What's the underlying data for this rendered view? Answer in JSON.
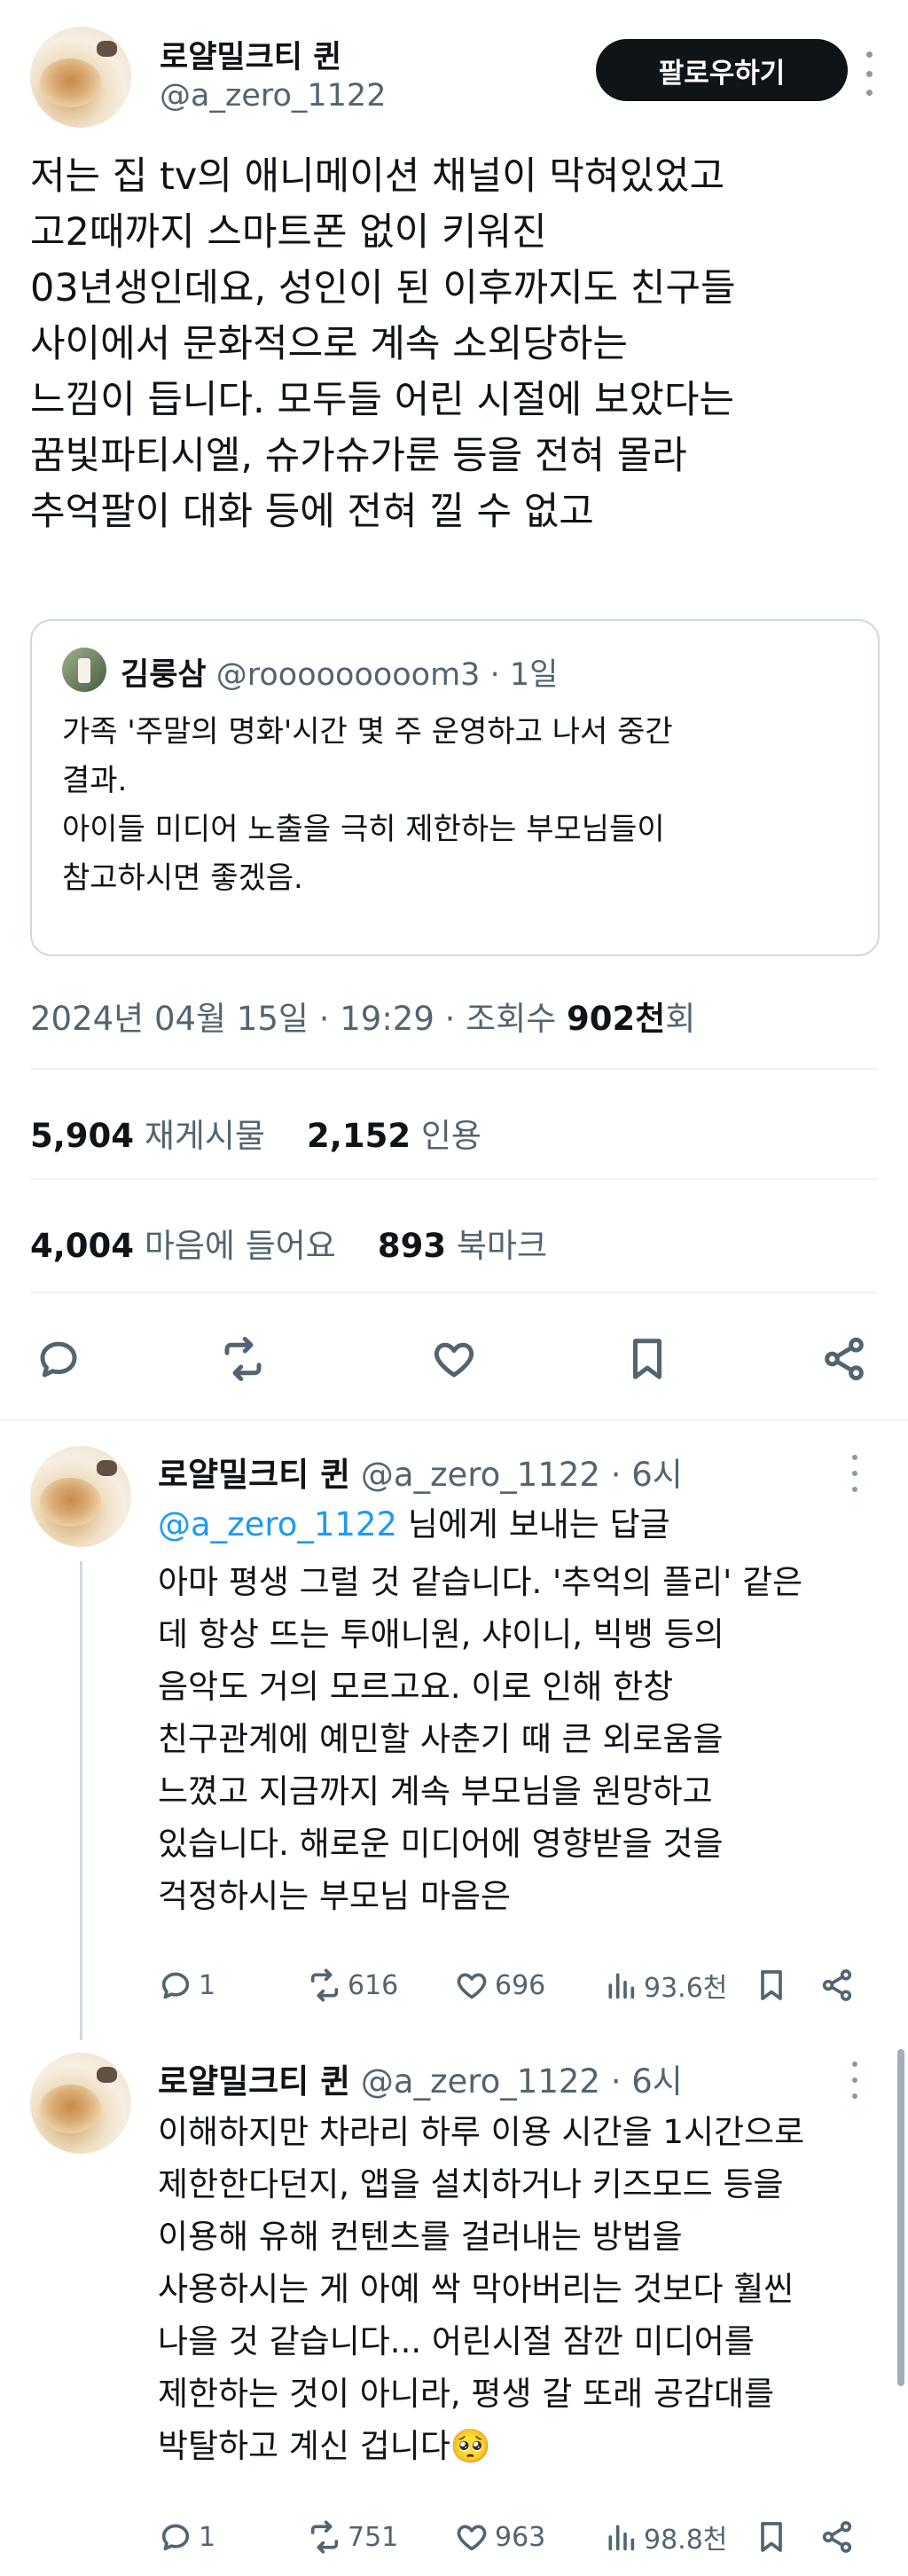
{
  "main_tweet": {
    "author_name": "로얄밀크티 퀸",
    "author_handle": "@a_zero_1122",
    "follow_label": "팔로우하기",
    "text_lines": [
      "저는 집 tv의 애니메이션 채널이 막혀있었고",
      "고2때까지 스마트폰 없이 키워진",
      "03년생인데요, 성인이 된 이후까지도 친구들",
      "사이에서 문화적으로 계속 소외당하는",
      "느낌이 듭니다. 모두들 어린 시절에 보았다는",
      "꿈빛파티시엘, 슈가슈가룬 등을 전혀 몰라",
      "추억팔이 대화 등에 전혀 낄 수 없고"
    ],
    "quote": {
      "name": "김룽삼",
      "handle_time": "@rooooooooom3 · 1일",
      "lines": [
        "가족 '주말의 명화'시간 몇 주 운영하고 나서 중간",
        "결과.",
        "아이들 미디어 노출을 극히 제한하는 부모님들이",
        "참고하시면 좋겠음."
      ]
    },
    "timestamp": "2024년 04월 15일 · 19:29 · 조회수 ",
    "views_number": "902천",
    "views_suffix": "회",
    "stats": {
      "retweets": "5,904",
      "retweets_label": "재게시물",
      "quotes": "2,152",
      "quotes_label": "인용",
      "likes": "4,004",
      "likes_label": "마음에 들어요",
      "bookmarks": "893",
      "bookmarks_label": "북마크"
    }
  },
  "replies": [
    {
      "name": "로얄밀크티 퀸",
      "meta": "@a_zero_1122 · 6시",
      "reply_to_handle": "@a_zero_1122",
      "reply_to_suffix": " 님에게 보내는 답글",
      "lines": [
        "아마 평생 그럴 것 같습니다. '추억의 플리' 같은",
        "데 항상 뜨는 투애니원, 샤이니, 빅뱅 등의",
        "음악도 거의 모르고요. 이로 인해 한창",
        "친구관계에 예민할 사춘기 때 큰 외로움을",
        "느꼈고 지금까지 계속 부모님을 원망하고",
        "있습니다. 해로운 미디어에 영향받을 것을",
        "걱정하시는 부모님 마음은"
      ],
      "replies_count": "1",
      "retweets_count": "616",
      "likes_count": "696",
      "views_count": "93.6천"
    },
    {
      "name": "로얄밀크티 퀸",
      "meta": "@a_zero_1122 · 6시",
      "lines": [
        "이해하지만 차라리 하루 이용 시간을 1시간으로",
        "제한한다던지, 앱을 설치하거나 키즈모드 등을",
        "이용해 유해 컨텐츠를 걸러내는 방법을",
        "사용하시는 게 아예 싹 막아버리는 것보다 훨씬",
        "나을 것 같습니다... 어린시절 잠깐 미디어를",
        "제한하는 것이 아니라, 평생 갈 또래 공감대를",
        "박탈하고 계신 겁니다🥺"
      ],
      "replies_count": "1",
      "retweets_count": "751",
      "likes_count": "963",
      "views_count": "98.8천"
    }
  ]
}
